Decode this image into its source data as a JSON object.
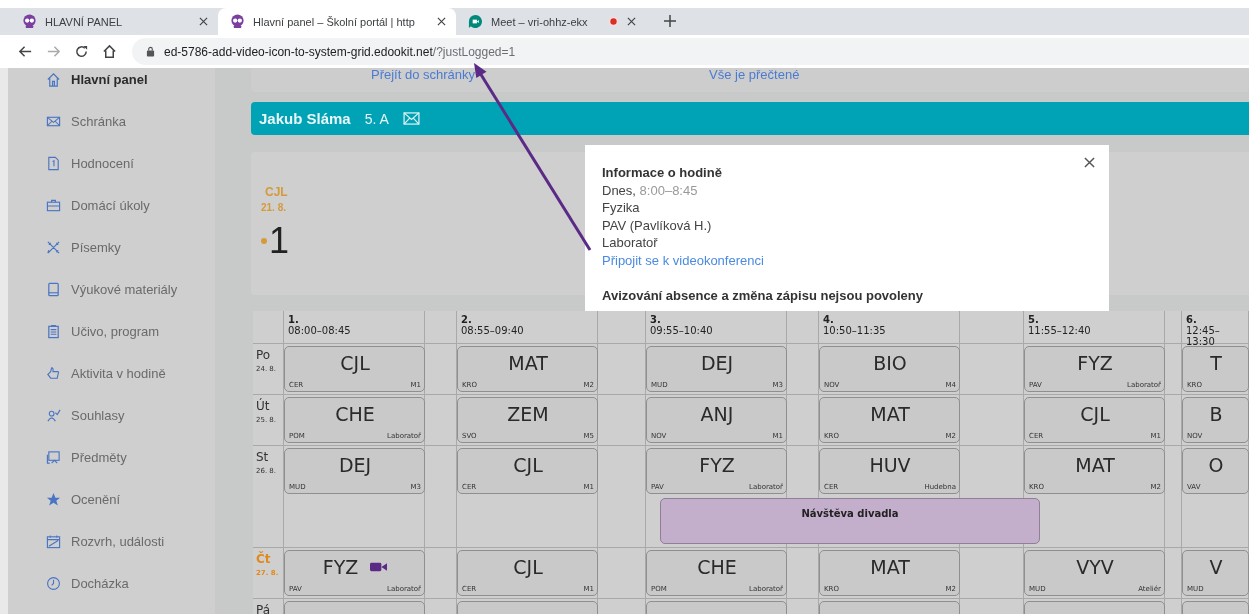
{
  "browser": {
    "tabs": [
      {
        "kind": "portal",
        "title": "HLAVNÍ PANEL",
        "selected": false,
        "recording": false
      },
      {
        "kind": "portal",
        "title": "Hlavní panel – Školní portál | http",
        "selected": true,
        "recording": false
      },
      {
        "kind": "meet",
        "title": "Meet – vri-ohhz-ekx",
        "selected": false,
        "recording": true
      }
    ],
    "address": {
      "host": "ed-5786-add-video-icon-to-system-grid.edookit.net",
      "path": "/?justLogged=1"
    }
  },
  "sidebar": {
    "items": [
      {
        "label": "Hlavní panel",
        "selected": true
      },
      {
        "label": "Schránka",
        "selected": false
      },
      {
        "label": "Hodnocení",
        "selected": false
      },
      {
        "label": "Domácí úkoly",
        "selected": false
      },
      {
        "label": "Písemky",
        "selected": false
      },
      {
        "label": "Výukové materiály",
        "selected": false
      },
      {
        "label": "Učivo, program",
        "selected": false
      },
      {
        "label": "Aktivita v hodině",
        "selected": false
      },
      {
        "label": "Souhlasy",
        "selected": false
      },
      {
        "label": "Předměty",
        "selected": false
      },
      {
        "label": "Ocenění",
        "selected": false
      },
      {
        "label": "Rozvrh, události",
        "selected": false
      },
      {
        "label": "Docházka",
        "selected": false
      }
    ]
  },
  "notice_bar": {
    "links": [
      "Přejít do schránky",
      "Vše je přečtené"
    ]
  },
  "student": {
    "name": "Jakub Sláma",
    "class": "5. A"
  },
  "grades": [
    {
      "subject": "CJL",
      "date": "21. 8.",
      "grade": "1"
    }
  ],
  "modal": {
    "title": "Informace o hodině",
    "day": "Dnes,",
    "time": "8:00–8:45",
    "subject": "Fyzika",
    "teacher": "PAV (Pavlíková H.)",
    "room": "Laboratoř",
    "link": "Připojit se k videokonferenci",
    "note": "Avizování absence a změna zápisu nejsou povoleny"
  },
  "timetable": {
    "periods": [
      {
        "number": "1.",
        "time": "08:00–08:45"
      },
      {
        "number": "2.",
        "time": "08:55–09:40"
      },
      {
        "number": "3.",
        "time": "09:55–10:40"
      },
      {
        "number": "4.",
        "time": "10:50–11:35"
      },
      {
        "number": "5.",
        "time": "11:55–12:40"
      },
      {
        "number": "6.",
        "time": "12:45–13:30"
      }
    ],
    "days": [
      {
        "name": "Po",
        "date": "24. 8.",
        "today": false,
        "lessons": [
          {
            "subject": "CJL",
            "teacher": "CER",
            "room": "M1",
            "video": false
          },
          {
            "subject": "MAT",
            "teacher": "KRO",
            "room": "M2",
            "video": false
          },
          {
            "subject": "DEJ",
            "teacher": "MUD",
            "room": "M3",
            "video": false
          },
          {
            "subject": "BIO",
            "teacher": "NOV",
            "room": "M4",
            "video": false
          },
          {
            "subject": "FYZ",
            "teacher": "PAV",
            "room": "Laboratoř",
            "video": false
          },
          {
            "subject": "T",
            "teacher": "KRO",
            "video": false
          }
        ]
      },
      {
        "name": "Út",
        "date": "25. 8.",
        "today": false,
        "lessons": [
          {
            "subject": "CHE",
            "teacher": "POM",
            "room": "Laboratoř",
            "video": false
          },
          {
            "subject": "ZEM",
            "teacher": "SVO",
            "room": "M5",
            "video": false
          },
          {
            "subject": "ANJ",
            "teacher": "NOV",
            "room": "M1",
            "video": false
          },
          {
            "subject": "MAT",
            "teacher": "KRO",
            "room": "M2",
            "video": false
          },
          {
            "subject": "CJL",
            "teacher": "CER",
            "room": "M1",
            "video": false
          },
          {
            "subject": "B",
            "teacher": "NOV",
            "video": false
          }
        ]
      },
      {
        "name": "St",
        "date": "26. 8.",
        "today": false,
        "lessons": [
          {
            "subject": "DEJ",
            "teacher": "MUD",
            "room": "M3",
            "video": false
          },
          {
            "subject": "CJL",
            "teacher": "CER",
            "room": "M1",
            "video": false
          },
          {
            "subject": "FYZ",
            "teacher": "PAV",
            "room": "Laboratoř",
            "video": false
          },
          {
            "subject": "HUV",
            "teacher": "CER",
            "room": "Hudebna",
            "video": false
          },
          {
            "subject": "MAT",
            "teacher": "KRO",
            "room": "M2",
            "video": false
          },
          {
            "subject": "O",
            "teacher": "VAV",
            "video": false
          }
        ],
        "events": [
          {
            "title": "Návštěva divadla"
          }
        ]
      },
      {
        "name": "Čt",
        "date": "27. 8.",
        "today": true,
        "lessons": [
          {
            "subject": "FYZ",
            "teacher": "PAV",
            "room": "Laboratoř",
            "video": true
          },
          {
            "subject": "CJL",
            "teacher": "CER",
            "room": "M1",
            "video": false
          },
          {
            "subject": "CHE",
            "teacher": "POM",
            "room": "Laboratoř",
            "video": false
          },
          {
            "subject": "MAT",
            "teacher": "KRO",
            "room": "M2",
            "video": false
          },
          {
            "subject": "VYV",
            "teacher": "MUD",
            "room": "Ateliér",
            "video": false
          },
          {
            "subject": "V",
            "teacher": "MUD",
            "video": false
          }
        ]
      },
      {
        "name": "Pá",
        "today": false
      }
    ]
  }
}
